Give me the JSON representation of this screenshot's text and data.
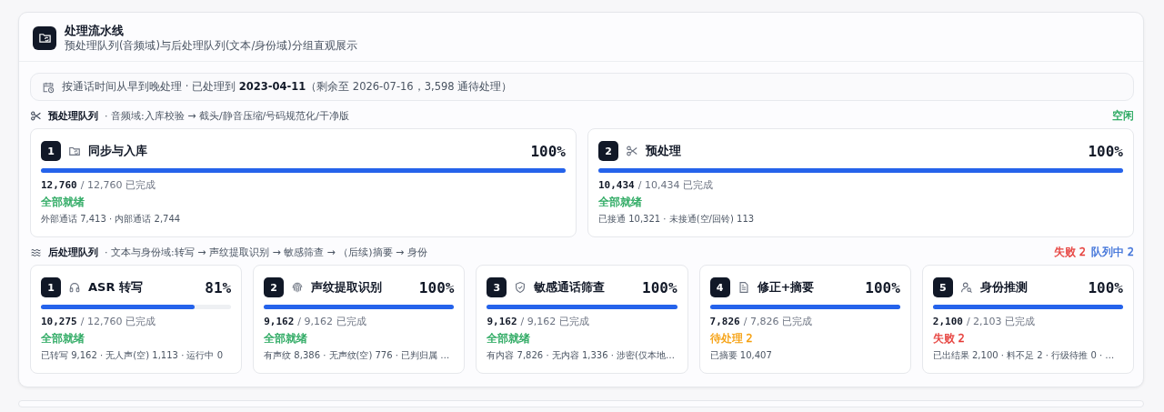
{
  "panel": {
    "title": "处理流水线",
    "subtitle": "预处理队列(音频域)与后处理队列(文本/身份域)分组直观展示"
  },
  "info_bar": {
    "text": "按通话时间从早到晚处理 · 已处理到 **2023-04-11**（剩余至 2026-07-16，3,598 通待处理）"
  },
  "queues": [
    {
      "kind": "pre",
      "title": "预处理队列",
      "description": "· 音频域:入库校验 → 截头/静音压缩/号码规范化/干净版",
      "badges": [
        {
          "text": "空闲",
          "color": "#22a55a"
        }
      ],
      "stages": [
        {
          "kind": "sync",
          "number": "1",
          "name": "同步与入库",
          "percent": "100%",
          "level": 1,
          "done": "12,760",
          "total": "/ 12,760 已完成",
          "status": "全部就绪",
          "color": "#22a55a",
          "details": "外部通话 7,413 · 内部通话 2,744"
        },
        {
          "kind": "cut",
          "number": "2",
          "name": "预处理",
          "percent": "100%",
          "level": 1,
          "done": "10,434",
          "total": "/ 10,434 已完成",
          "status": "全部就绪",
          "color": "#22a55a",
          "details": "已接通 10,321 · 未接通(空/回铃) 113"
        }
      ]
    },
    {
      "kind": "post",
      "title": "后处理队列",
      "description": "· 文本与身份域:转写 → 声纹提取识别 → 敏感筛查 → （后续)摘要 → 身份",
      "badges": [
        {
          "text": "失败 2",
          "color": "#e53935"
        },
        {
          "text": "队列中 2",
          "color": "#3b6fd8"
        }
      ],
      "stages": [
        {
          "kind": "asr",
          "number": "1",
          "name": "ASR 转写",
          "percent": "81%",
          "level": 0.81,
          "done": "10,275",
          "total": "/ 12,760 已完成",
          "status": "全部就绪",
          "color": "#22a55a",
          "details": "已转写 9,162 · 无人声(空) 1,113 · 运行中 0"
        },
        {
          "kind": "voiceprint",
          "number": "2",
          "name": "声纹提取识别",
          "percent": "100%",
          "level": 1,
          "done": "9,162",
          "total": "/ 9,162 已完成",
          "status": "全部就绪",
          "color": "#22a55a",
          "details": "有声纹 8,386 · 无声纹(空) 776 · 已判归属 …"
        },
        {
          "kind": "screen",
          "number": "3",
          "name": "敏感通话筛查",
          "percent": "100%",
          "level": 1,
          "done": "9,162",
          "total": "/ 9,162 已完成",
          "status": "全部就绪",
          "color": "#22a55a",
          "details": "有内容 7,826 · 无内容 1,336 · 涉密(仅本地…"
        },
        {
          "kind": "summary",
          "number": "4",
          "name": "修正+摘要",
          "percent": "100%",
          "level": 1,
          "done": "7,826",
          "total": "/ 7,826 已完成",
          "status": "待处理 2",
          "color": "#f59e0b",
          "details": "已摘要 10,407"
        },
        {
          "kind": "identity",
          "number": "5",
          "name": "身份推测",
          "percent": "100%",
          "level": 1,
          "done": "2,100",
          "total": "/ 2,103 已完成",
          "status": "失败 2",
          "color": "#e53935",
          "details": "已出结果 2,100 · 料不足 2 · 行级待推 0 · …"
        }
      ]
    }
  ]
}
